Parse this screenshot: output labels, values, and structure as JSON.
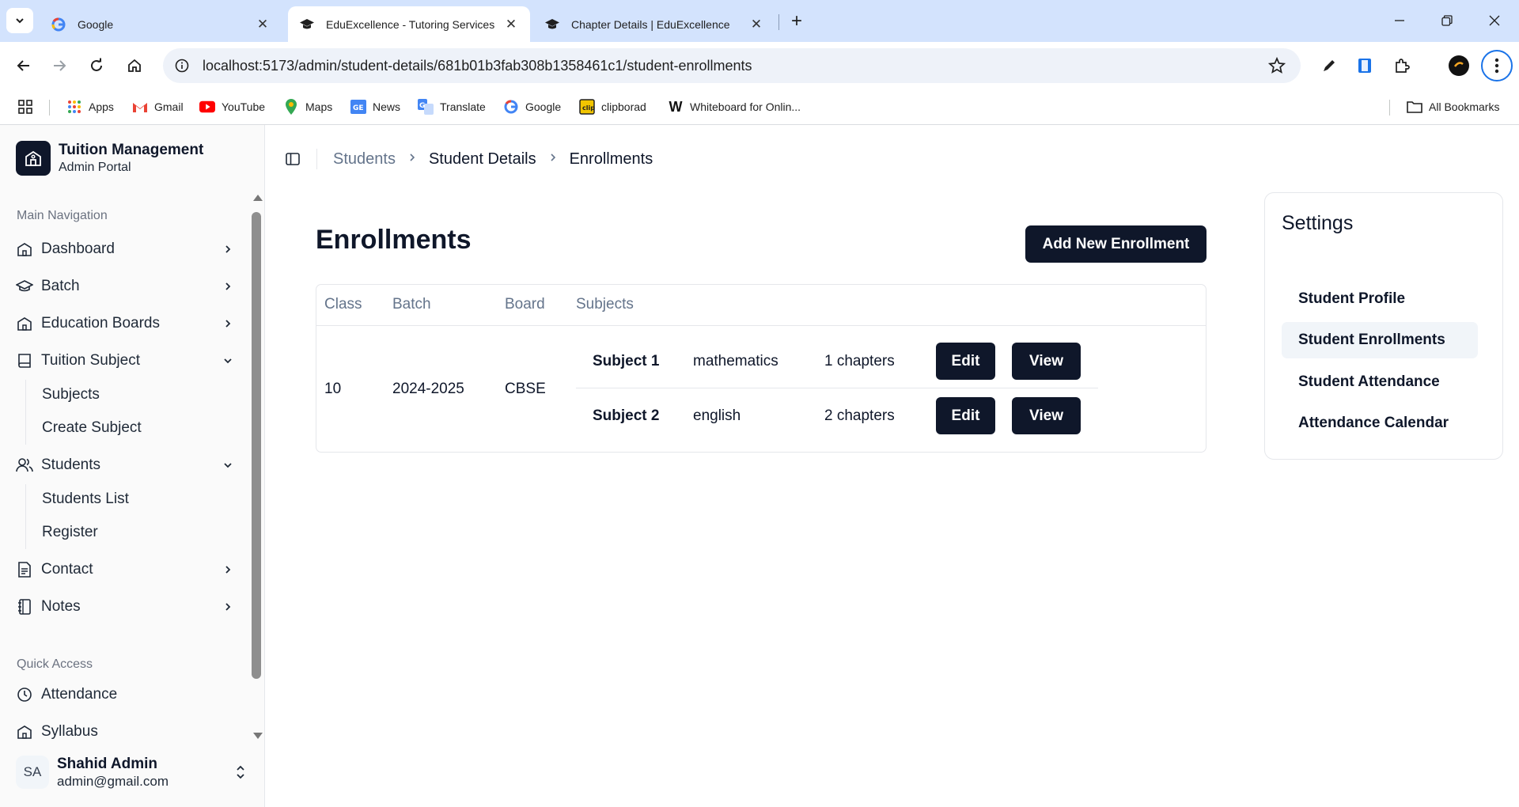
{
  "browser": {
    "tabs": [
      {
        "title": "Google"
      },
      {
        "title": "EduExcellence - Tutoring Services"
      },
      {
        "title": "Chapter Details | EduExcellence"
      }
    ],
    "url": "localhost:5173/admin/student-details/681b01b3fab308b1358461c1/student-enrollments",
    "bookmarks": [
      "Apps",
      "Gmail",
      "YouTube",
      "Maps",
      "News",
      "Translate",
      "Google",
      "clipborad",
      "Whiteboard for Onlin..."
    ],
    "all_bookmarks": "All Bookmarks"
  },
  "sidebar": {
    "brand_title": "Tuition Management",
    "brand_subtitle": "Admin Portal",
    "main_label": "Main Navigation",
    "items": [
      {
        "label": "Dashboard"
      },
      {
        "label": "Batch"
      },
      {
        "label": "Education Boards"
      },
      {
        "label": "Tuition Subject"
      },
      {
        "label": "Students"
      },
      {
        "label": "Contact"
      },
      {
        "label": "Notes"
      }
    ],
    "tuition_subject_children": [
      "Subjects",
      "Create Subject"
    ],
    "students_children": [
      "Students List",
      "Register"
    ],
    "quick_label": "Quick Access",
    "quick_items": [
      {
        "label": "Attendance"
      },
      {
        "label": "Syllabus"
      }
    ],
    "user": {
      "initials": "SA",
      "name": "Shahid Admin",
      "email": "admin@gmail.com"
    }
  },
  "breadcrumb": [
    "Students",
    "Student Details",
    "Enrollments"
  ],
  "main": {
    "title": "Enrollments",
    "add_button": "Add New Enrollment",
    "columns": [
      "Class",
      "Batch",
      "Board",
      "Subjects"
    ],
    "row": {
      "class": "10",
      "batch": "2024-2025",
      "board": "CBSE",
      "subjects": [
        {
          "label": "Subject 1",
          "name": "mathematics",
          "chapters": "1 chapters"
        },
        {
          "label": "Subject 2",
          "name": "english",
          "chapters": "2 chapters"
        }
      ]
    },
    "edit_label": "Edit",
    "view_label": "View"
  },
  "settings": {
    "title": "Settings",
    "items": [
      "Student Profile",
      "Student Enrollments",
      "Student Attendance",
      "Attendance Calendar"
    ],
    "active_index": 1
  }
}
